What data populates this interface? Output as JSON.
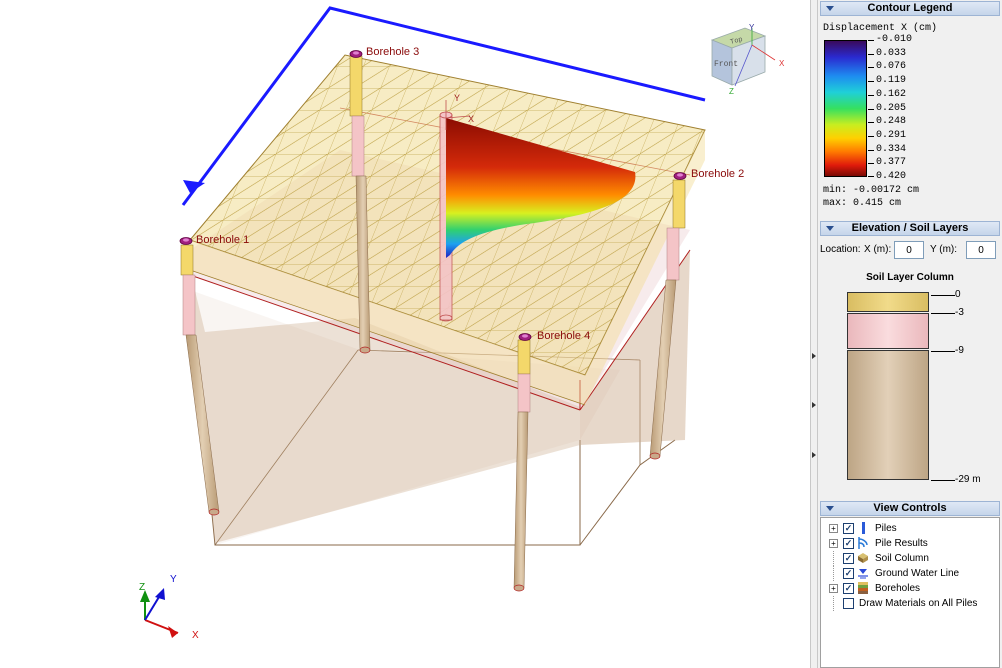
{
  "viewport": {
    "boreholes": [
      "Borehole 1",
      "Borehole 2",
      "Borehole 3",
      "Borehole 4"
    ],
    "local_axis": {
      "y": "Y",
      "x": "X"
    },
    "view_cube": {
      "top": "Top",
      "front": "Front",
      "y": "Y",
      "x": "X",
      "z": "Z"
    },
    "triad": {
      "x": "X",
      "y": "Y",
      "z": "Z"
    }
  },
  "contour_legend": {
    "header": "Contour Legend",
    "title": "Displacement X (cm)",
    "ticks": [
      "-0.010",
      "0.033",
      "0.076",
      "0.119",
      "0.162",
      "0.205",
      "0.248",
      "0.291",
      "0.334",
      "0.377",
      "0.420"
    ],
    "min_text": "min: -0.00172 cm",
    "max_text": "max: 0.415 cm"
  },
  "elevation": {
    "header": "Elevation / Soil Layers",
    "location_label": "Location:",
    "x_label": "X (m):",
    "x_value": "0",
    "y_label": "Y (m):",
    "y_value": "0",
    "column_title": "Soil Layer Column",
    "depths": [
      "0",
      "-3",
      "-9",
      "-29 m"
    ],
    "layer_colors": [
      "#e6cf7e",
      "#f5cfd2",
      "#cdb89c"
    ]
  },
  "view_controls": {
    "header": "View Controls",
    "items": [
      {
        "label": "Piles",
        "checked": true,
        "expandable": true,
        "icon": "pile-icon"
      },
      {
        "label": "Pile Results",
        "checked": true,
        "expandable": true,
        "icon": "pile-results-icon"
      },
      {
        "label": "Soil Column",
        "checked": true,
        "expandable": false,
        "icon": "soil-column-icon"
      },
      {
        "label": "Ground Water Line",
        "checked": true,
        "expandable": false,
        "icon": "water-line-icon"
      },
      {
        "label": "Boreholes",
        "checked": true,
        "expandable": true,
        "icon": "borehole-icon"
      },
      {
        "label": "Draw Materials on All Piles",
        "checked": false,
        "expandable": false,
        "icon": ""
      }
    ]
  }
}
